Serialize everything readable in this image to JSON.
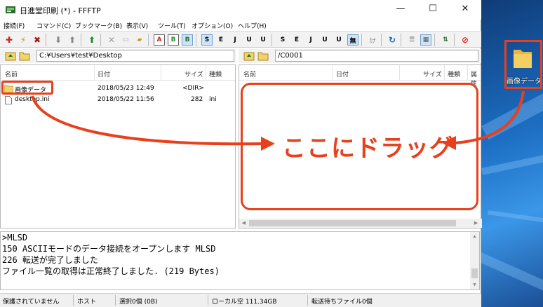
{
  "window": {
    "title": "日進堂印刷 (*) - FFFTP",
    "minimize": "—",
    "maximize": "☐",
    "close": "✕"
  },
  "menu": [
    "接続(F)",
    "コマンド(C)",
    "ブックマーク(B)",
    "表示(V)",
    "ツール(T)",
    "オプション(O)",
    "ヘルプ(H)"
  ],
  "toolbar": {
    "labels": {
      "ascii": "A",
      "binary": "B",
      "auto": "B",
      "sjis": "S",
      "euc": "E",
      "jis": "J",
      "utf8": "U",
      "utf8bom": "U",
      "s2": "S",
      "e2": "E",
      "j2": "J",
      "u2": "U",
      "u3": "U",
      "none": "無",
      "kana": "ｶﾅ"
    }
  },
  "local": {
    "path": "C:¥Users¥test¥Desktop",
    "headers": {
      "name": "名前",
      "date": "日付",
      "size": "サイズ",
      "type": "種類"
    },
    "rows": [
      {
        "name": "画像データ",
        "date": "2018/05/23 12:49",
        "size": "<DIR>",
        "type": ""
      },
      {
        "name": "desktop.ini",
        "date": "2018/05/22 11:56",
        "size": "282",
        "type": "ini"
      }
    ]
  },
  "remote": {
    "path": "/C0001",
    "headers": {
      "name": "名前",
      "date": "日付",
      "size": "サイズ",
      "type": "種類",
      "attr": "属性"
    }
  },
  "log": [
    ">MLSD",
    "150 ASCIIモードのデータ接続をオープンします MLSD",
    "226 転送が完了しました",
    "ファイル一覧の取得は正常終了しました. (219 Bytes)"
  ],
  "status": {
    "connection": "保護されていません",
    "host": "ホスト",
    "selected": "選択0個 (0B)",
    "local_free": "ローカル空 111.34GB",
    "queue": "転送待ちファイル0個"
  },
  "desktop": {
    "folder_label": "画像データ"
  },
  "annotation": {
    "text": "ここにドラッグ",
    "color": "#e8401c"
  }
}
